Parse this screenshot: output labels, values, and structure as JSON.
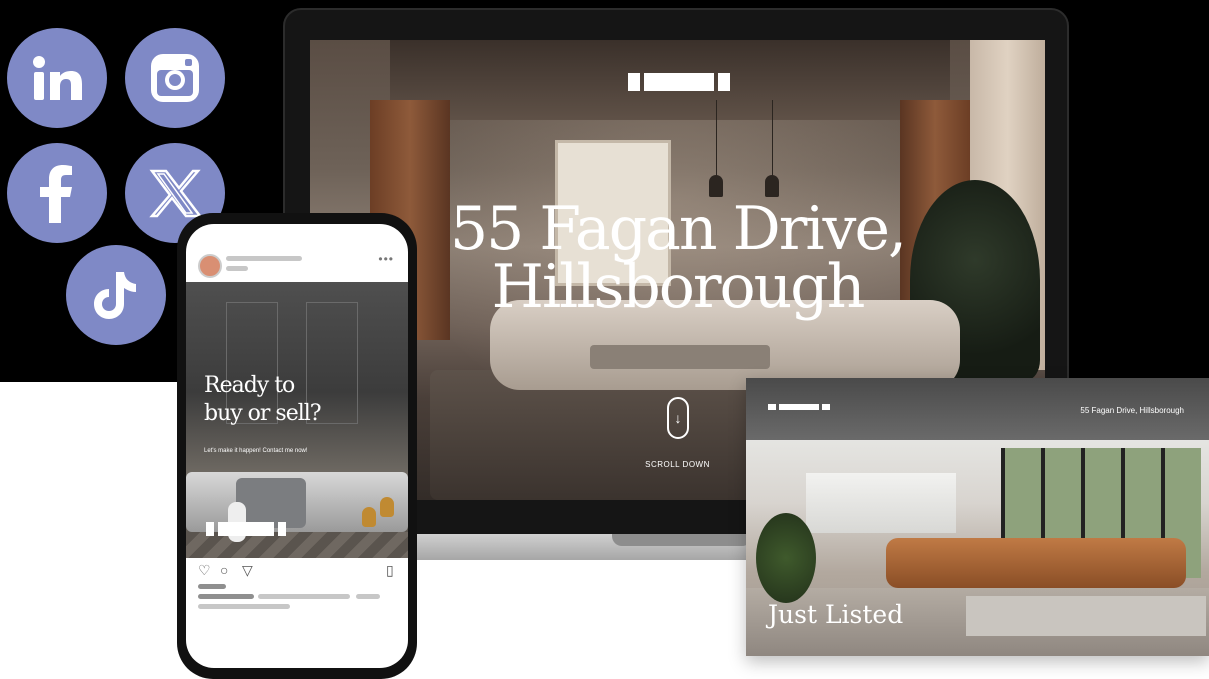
{
  "icons": {
    "linkedin": "linkedin-icon",
    "instagram": "instagram-icon",
    "facebook": "facebook-icon",
    "x": "x-icon",
    "tiktok": "tiktok-icon"
  },
  "colors": {
    "social_circle": "#7f89c6",
    "background": "#000000",
    "white": "#ffffff"
  },
  "laptop": {
    "hero_title_line1": "55 Fagan Drive,",
    "hero_title_line2": "Hillsborough",
    "scroll_label": "SCROLL DOWN"
  },
  "card": {
    "address": "55 Fagan Drive, Hillsborough",
    "tag": "Just Listed"
  },
  "phone": {
    "headline_line1": "Ready to",
    "headline_line2": "buy or sell?",
    "subtext": "Let's make it happen! Contact me now!"
  }
}
